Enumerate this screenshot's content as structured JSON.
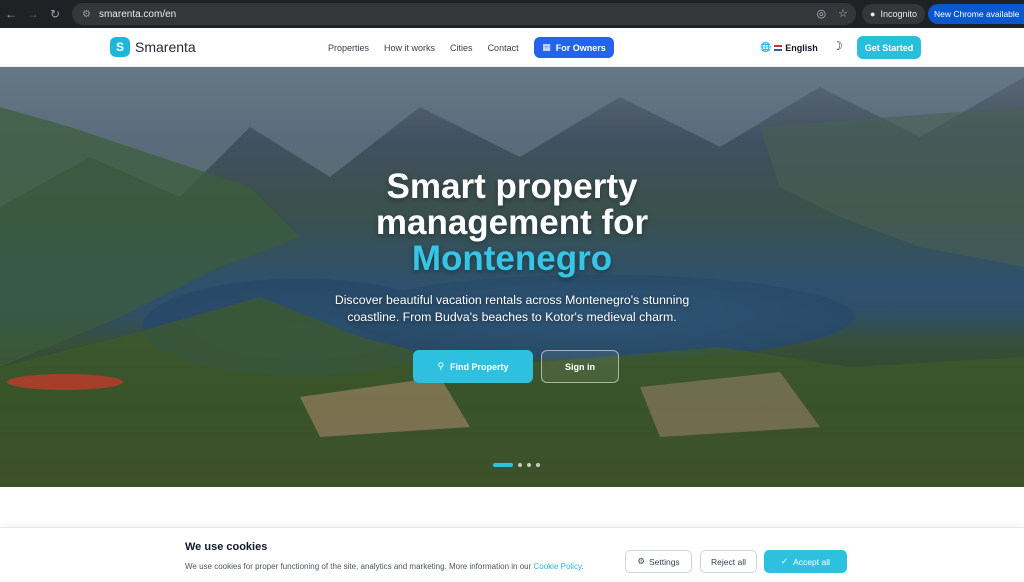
{
  "browser": {
    "url": "smarenta.com/en",
    "incognito_label": "Incognito",
    "update_label": "New Chrome available"
  },
  "header": {
    "logo_letter": "S",
    "logo_text": "Smarenta",
    "nav": [
      "Properties",
      "How it works",
      "Cities",
      "Contact"
    ],
    "owners_label": "For Owners",
    "language_label": "English",
    "get_started_label": "Get Started"
  },
  "hero": {
    "title_line1": "Smart property",
    "title_line2": "management for",
    "title_accent": "Montenegro",
    "subtitle": "Discover beautiful vacation rentals across Montenegro's stunning coastline. From Budva's beaches to Kotor's medieval charm.",
    "find_label": "Find Property",
    "signin_label": "Sign in",
    "slide_count": 4,
    "active_slide": 1
  },
  "cookie": {
    "title": "We use cookies",
    "text": "We use cookies for proper functioning of the site, analytics and marketing. More information in our",
    "link_text": "Cookie Policy",
    "trailing": ".",
    "settings_label": "Settings",
    "reject_label": "Reject all",
    "accept_label": "Accept all"
  },
  "colors": {
    "brand": "#2ec1df",
    "owners_blue": "#2563eb",
    "chrome_update_blue": "#0b57d0"
  },
  "icons": [
    "back-arrow-icon",
    "forward-arrow-icon",
    "reload-icon",
    "site-info-icon",
    "eye-off-icon",
    "star-icon",
    "incognito-icon",
    "building-icon",
    "globe-icon",
    "moon-icon",
    "search-icon",
    "gear-icon",
    "check-icon"
  ]
}
